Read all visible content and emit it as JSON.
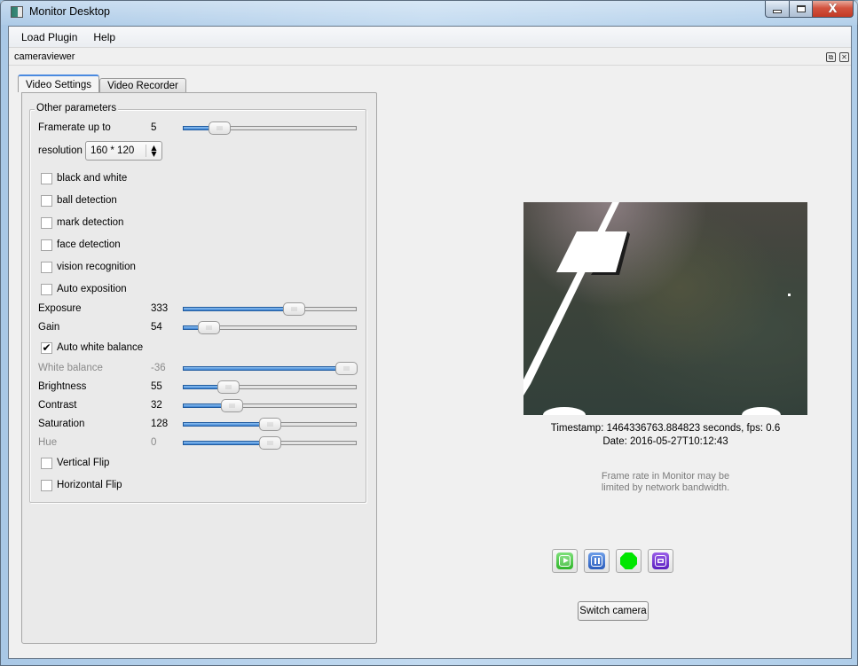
{
  "window": {
    "title": "Monitor Desktop",
    "controls": {
      "minimize": "minimize",
      "maximize": "maximize",
      "close": "close"
    }
  },
  "menubar": {
    "items": [
      {
        "label": "Load Plugin"
      },
      {
        "label": "Help"
      }
    ]
  },
  "dock": {
    "title": "cameraviewer",
    "float_icon": "⧉",
    "close_icon": "✕"
  },
  "tabs": [
    {
      "label": "Video Settings",
      "active": true
    },
    {
      "label": "Video Recorder",
      "active": false
    }
  ],
  "settings": {
    "group_title": "Other parameters",
    "framerate": {
      "label": "Framerate up to",
      "value": "5",
      "fraction": 0.21
    },
    "resolution": {
      "label": "resolution",
      "value": "160 * 120",
      "arrows": "▲\n▼"
    },
    "checkboxes_top": [
      {
        "label": "black and white",
        "checked": false
      },
      {
        "label": "ball detection",
        "checked": false
      },
      {
        "label": "mark detection",
        "checked": false
      },
      {
        "label": "face detection",
        "checked": false
      },
      {
        "label": "vision recognition",
        "checked": false
      },
      {
        "label": "Auto exposition",
        "checked": false
      }
    ],
    "exposure": {
      "label": "Exposure",
      "value": "333",
      "fraction": 0.64,
      "enabled": true
    },
    "gain": {
      "label": "Gain",
      "value": "54",
      "fraction": 0.15,
      "enabled": true
    },
    "auto_white_balance": {
      "label": "Auto white balance",
      "checked": true,
      "mark": "✔"
    },
    "white_balance": {
      "label": "White balance",
      "value": "-36",
      "fraction": 0.94,
      "enabled": false
    },
    "brightness": {
      "label": "Brightness",
      "value": "55",
      "fraction": 0.26,
      "enabled": true
    },
    "contrast": {
      "label": "Contrast",
      "value": "32",
      "fraction": 0.28,
      "enabled": true
    },
    "saturation": {
      "label": "Saturation",
      "value": "128",
      "fraction": 0.5,
      "enabled": true
    },
    "hue": {
      "label": "Hue",
      "value": "0",
      "fraction": 0.5,
      "enabled": false
    },
    "checkboxes_bottom": [
      {
        "label": "Vertical Flip",
        "checked": false
      },
      {
        "label": "Horizontal Flip",
        "checked": false
      }
    ]
  },
  "camera": {
    "timestamp_line": "Timestamp: 1464336763.884823 seconds,  fps: 0.6",
    "date_line": "Date: 2016-05-27T10:12:43",
    "note_line1": "Frame rate in Monitor may be",
    "note_line2": "limited by network bandwidth.",
    "buttons": [
      {
        "name": "play",
        "icon": "play-icon",
        "color": "#2fb52a"
      },
      {
        "name": "pause",
        "icon": "pause-icon",
        "color": "#2a5dbd"
      },
      {
        "name": "record",
        "icon": "record-icon",
        "color": "#00e600"
      },
      {
        "name": "snapshot",
        "icon": "camera-icon",
        "color": "#5a1fc0"
      }
    ],
    "switch_label": "Switch camera"
  }
}
